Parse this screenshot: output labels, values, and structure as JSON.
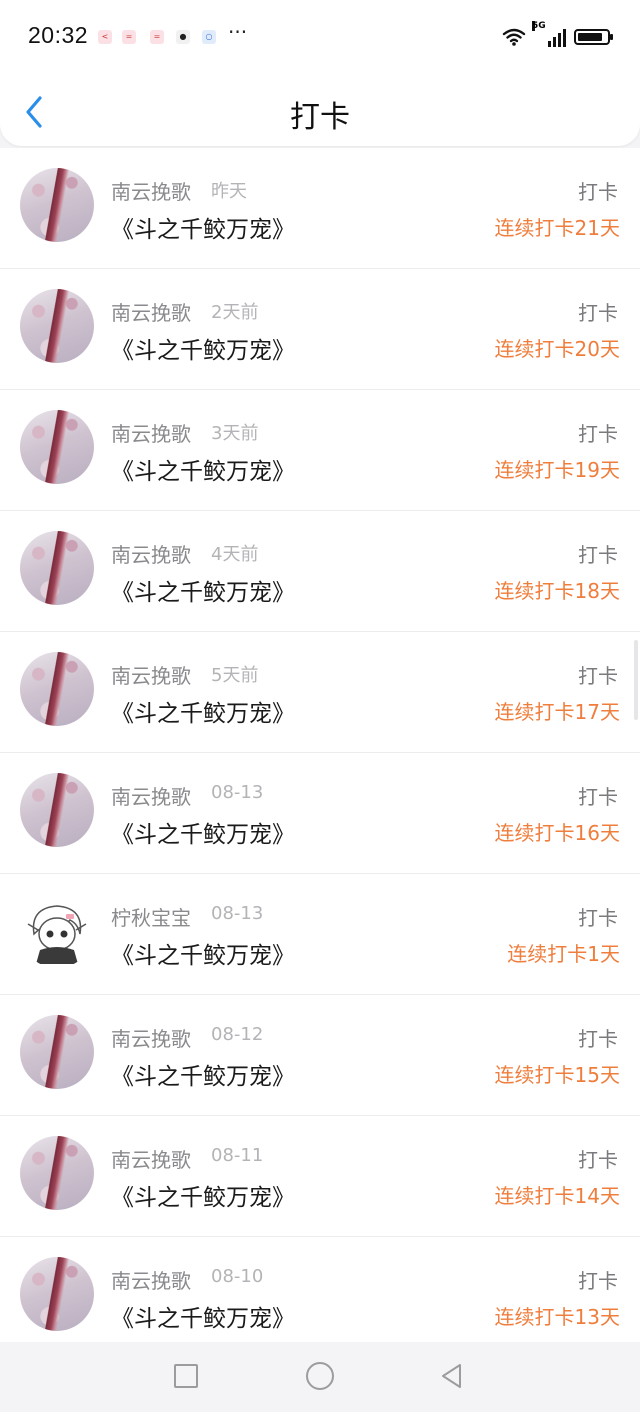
{
  "status_bar": {
    "time": "20:32",
    "more": "···",
    "network": "5G",
    "battery_level": 0.85,
    "icons": [
      "wifi-icon",
      "signal-icon",
      "battery-icon"
    ]
  },
  "header": {
    "title": "打卡",
    "back_icon": "chevron-left-icon",
    "accent": "#2b8ee8"
  },
  "colors": {
    "streak": "#ef7d3c",
    "name": "#8a8a8e",
    "time": "#b4b4b8"
  },
  "items": [
    {
      "user": "南云挽歌",
      "time": "昨天",
      "book": "《斗之千鲛万宠》",
      "action": "打卡",
      "streak": "连续打卡21天",
      "avatar": "flower"
    },
    {
      "user": "南云挽歌",
      "time": "2天前",
      "book": "《斗之千鲛万宠》",
      "action": "打卡",
      "streak": "连续打卡20天",
      "avatar": "flower"
    },
    {
      "user": "南云挽歌",
      "time": "3天前",
      "book": "《斗之千鲛万宠》",
      "action": "打卡",
      "streak": "连续打卡19天",
      "avatar": "flower"
    },
    {
      "user": "南云挽歌",
      "time": "4天前",
      "book": "《斗之千鲛万宠》",
      "action": "打卡",
      "streak": "连续打卡18天",
      "avatar": "flower"
    },
    {
      "user": "南云挽歌",
      "time": "5天前",
      "book": "《斗之千鲛万宠》",
      "action": "打卡",
      "streak": "连续打卡17天",
      "avatar": "flower"
    },
    {
      "user": "南云挽歌",
      "time": "08-13",
      "book": "《斗之千鲛万宠》",
      "action": "打卡",
      "streak": "连续打卡16天",
      "avatar": "flower"
    },
    {
      "user": "柠秋宝宝",
      "time": "08-13",
      "book": "《斗之千鲛万宠》",
      "action": "打卡",
      "streak": "连续打卡1天",
      "avatar": "anime"
    },
    {
      "user": "南云挽歌",
      "time": "08-12",
      "book": "《斗之千鲛万宠》",
      "action": "打卡",
      "streak": "连续打卡15天",
      "avatar": "flower"
    },
    {
      "user": "南云挽歌",
      "time": "08-11",
      "book": "《斗之千鲛万宠》",
      "action": "打卡",
      "streak": "连续打卡14天",
      "avatar": "flower"
    },
    {
      "user": "南云挽歌",
      "time": "08-10",
      "book": "《斗之千鲛万宠》",
      "action": "打卡",
      "streak": "连续打卡13天",
      "avatar": "flower"
    }
  ],
  "nav_bar": {
    "buttons": [
      "recent-apps-button",
      "home-button",
      "back-button"
    ]
  }
}
